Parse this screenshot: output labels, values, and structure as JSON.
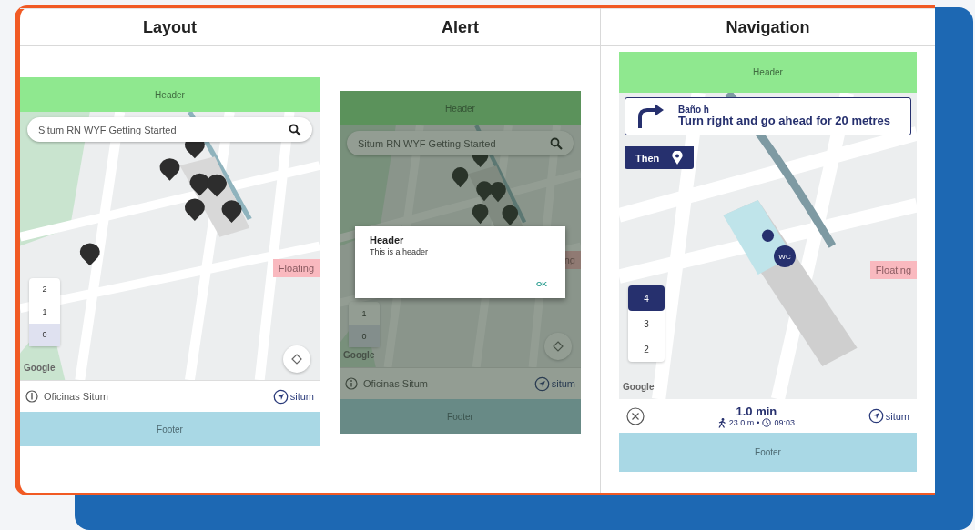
{
  "columns": [
    {
      "title": "Layout",
      "screen": {
        "kind": "map",
        "header": "Header",
        "search": {
          "placeholder": "Situm RN WYF Getting Started"
        },
        "floating": "Floating",
        "floors": [
          {
            "label": "2",
            "selected": false
          },
          {
            "label": "1",
            "selected": false
          },
          {
            "label": "0",
            "selected": true
          }
        ],
        "map_logo": "Google",
        "building": "Oficinas Situm",
        "brand": "situm",
        "footer": "Footer"
      }
    },
    {
      "title": "Alert",
      "screen": {
        "kind": "alert",
        "header": "Header",
        "search": {
          "placeholder": "Situm RN WYF Getting Started"
        },
        "floating": "ng",
        "floors": [
          {
            "label": "1",
            "selected": false
          },
          {
            "label": "0",
            "selected": true
          }
        ],
        "map_logo": "Google",
        "building": "Oficinas Situm",
        "brand": "situm",
        "footer": "Footer",
        "dialog": {
          "title": "Header",
          "message": "This is a header",
          "button": "OK"
        }
      }
    },
    {
      "title": "Navigation",
      "screen": {
        "kind": "navigation",
        "header": "Header",
        "instruction": {
          "destination": "Baño h",
          "text": "Turn right and go ahead for 20 metres",
          "then": "Then"
        },
        "marker": "WC",
        "floating": "Floating",
        "floors": [
          {
            "label": "4",
            "selected": true
          },
          {
            "label": "3",
            "selected": false
          },
          {
            "label": "2",
            "selected": false
          }
        ],
        "map_logo": "Google",
        "duration": "1.0 min",
        "distance": "23.0 m",
        "separator": "•",
        "arrival": "09:03",
        "brand": "situm",
        "footer": "Footer"
      }
    }
  ]
}
